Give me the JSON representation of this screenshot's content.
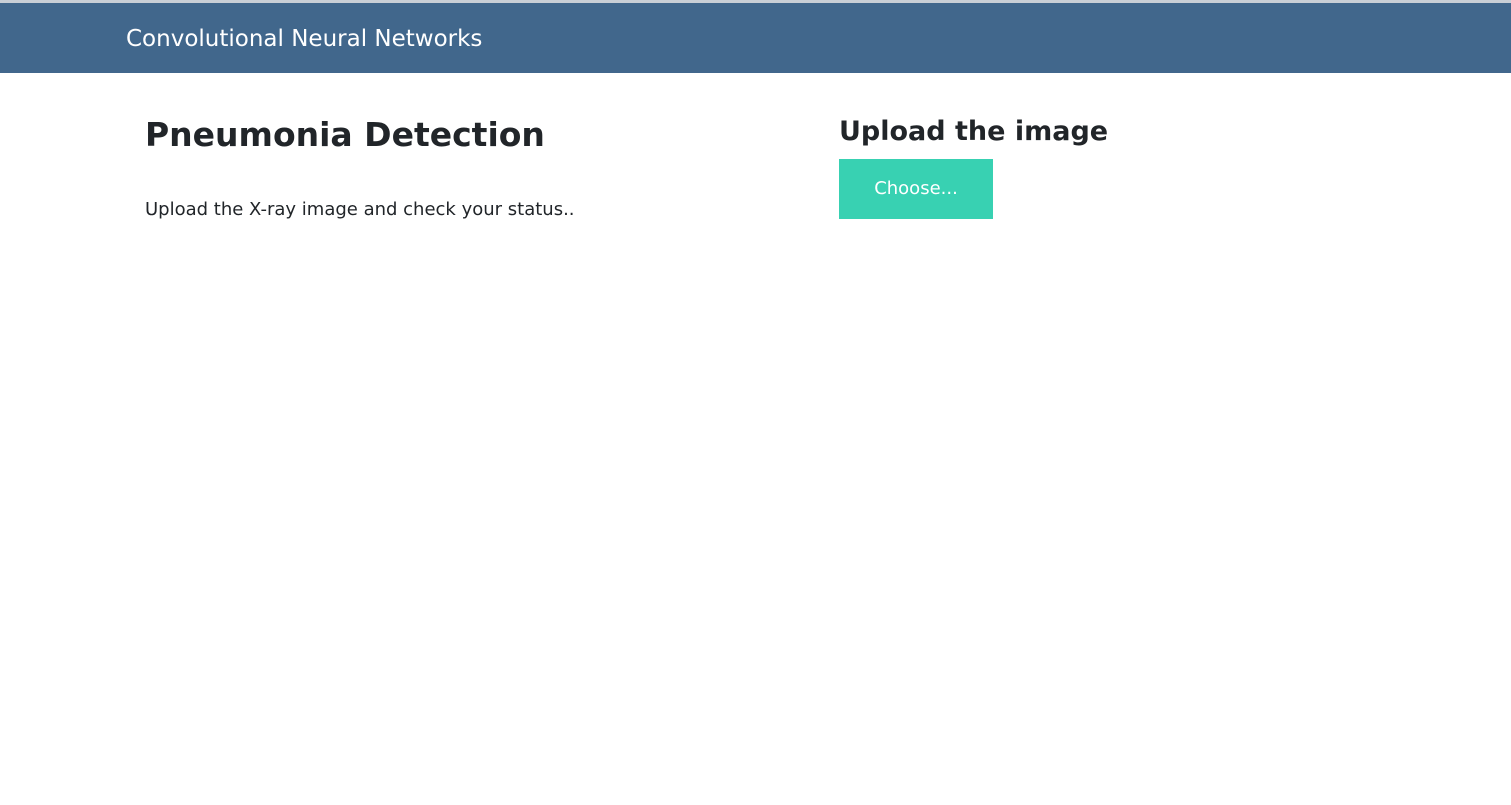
{
  "navbar": {
    "brand": "Convolutional Neural Networks",
    "background_color": "#41678c"
  },
  "main": {
    "title": "Pneumonia Detection",
    "subtitle": "Upload the X-ray image and check your status.."
  },
  "upload": {
    "title": "Upload the image",
    "choose_label": "Choose...",
    "button_color": "#38d1b2"
  }
}
